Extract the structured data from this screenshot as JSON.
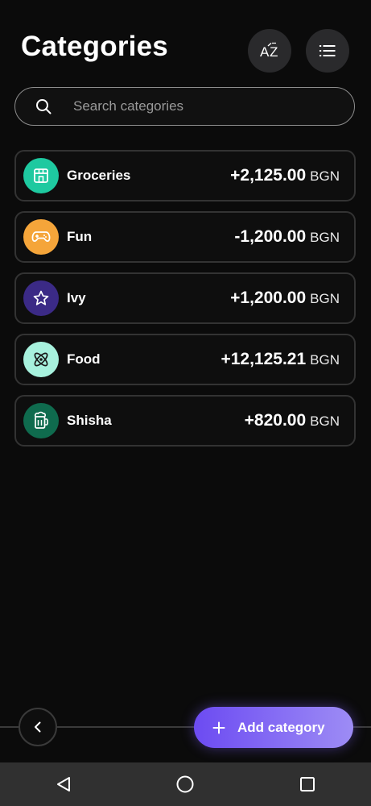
{
  "header": {
    "title": "Categories",
    "sort_icon_text": "AZ"
  },
  "search": {
    "placeholder": "Search categories",
    "value": ""
  },
  "categories": [
    {
      "name": "Groceries",
      "amount": "+2,125.00",
      "currency": "BGN",
      "icon": "storefront-icon",
      "color": "#1ec9a0"
    },
    {
      "name": "Fun",
      "amount": "-1,200.00",
      "currency": "BGN",
      "icon": "gamepad-icon",
      "color": "#f5a53a"
    },
    {
      "name": "Ivy",
      "amount": "+1,200.00",
      "currency": "BGN",
      "icon": "star-icon",
      "color": "#3b2a86"
    },
    {
      "name": "Food",
      "amount": "+12,125.21",
      "currency": "BGN",
      "icon": "atom-icon",
      "color": "#a7f1dd"
    },
    {
      "name": "Shisha",
      "amount": "+820.00",
      "currency": "BGN",
      "icon": "beer-mug-icon",
      "color": "#0f6b4e"
    }
  ],
  "footer": {
    "add_label": "Add category"
  },
  "colors": {
    "accent_start": "#6c4bf2",
    "accent_end": "#9d8cf5",
    "background": "#0b0b0b"
  }
}
